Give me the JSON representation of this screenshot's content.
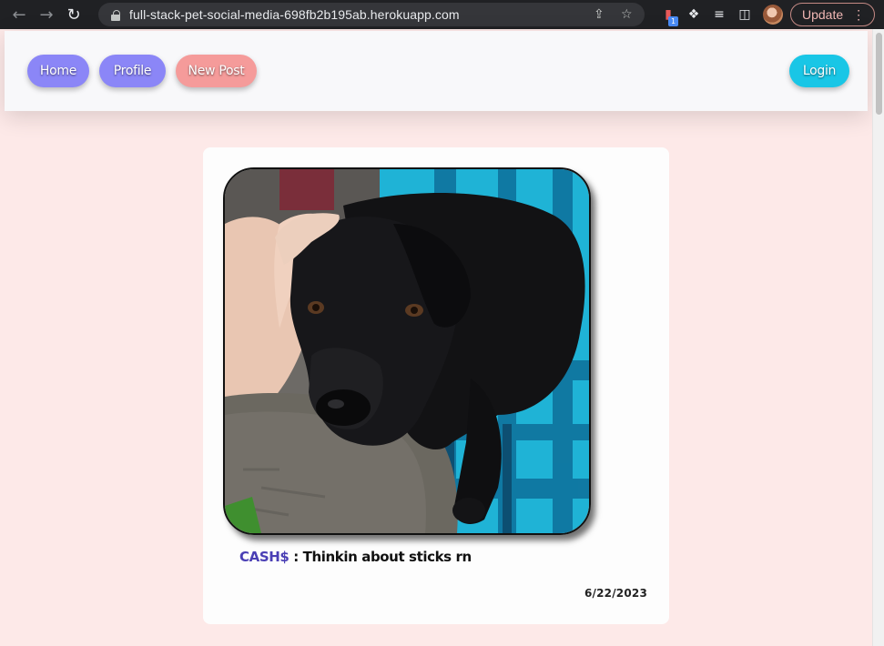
{
  "browser": {
    "url": "full-stack-pet-social-media-698fb2b195ab.herokuapp.com",
    "extension_badge": "1",
    "update_label": "Update",
    "icons": [
      "back-arrow-icon",
      "forward-arrow-icon",
      "reload-icon",
      "lock-icon",
      "share-icon",
      "star-icon",
      "extension-icon",
      "puzzle-icon",
      "reading-list-icon",
      "side-panel-icon",
      "avatar",
      "kebab-menu-icon"
    ]
  },
  "navbar": {
    "home": "Home",
    "profile": "Profile",
    "new_post": "New Post",
    "login": "Login"
  },
  "post": {
    "username": "CASH$",
    "separator": " : ",
    "text": "Thinkin about sticks rn",
    "date": "6/22/2023",
    "image_alt": "black dog resting head on lap on blue plaid blanket"
  },
  "colors": {
    "page_bg": "#fde9e8",
    "primary_pill": "#8b86f7",
    "new_post_pill": "#f59b9a",
    "login_pill": "#19c6e6",
    "username": "#4a3fb5"
  }
}
